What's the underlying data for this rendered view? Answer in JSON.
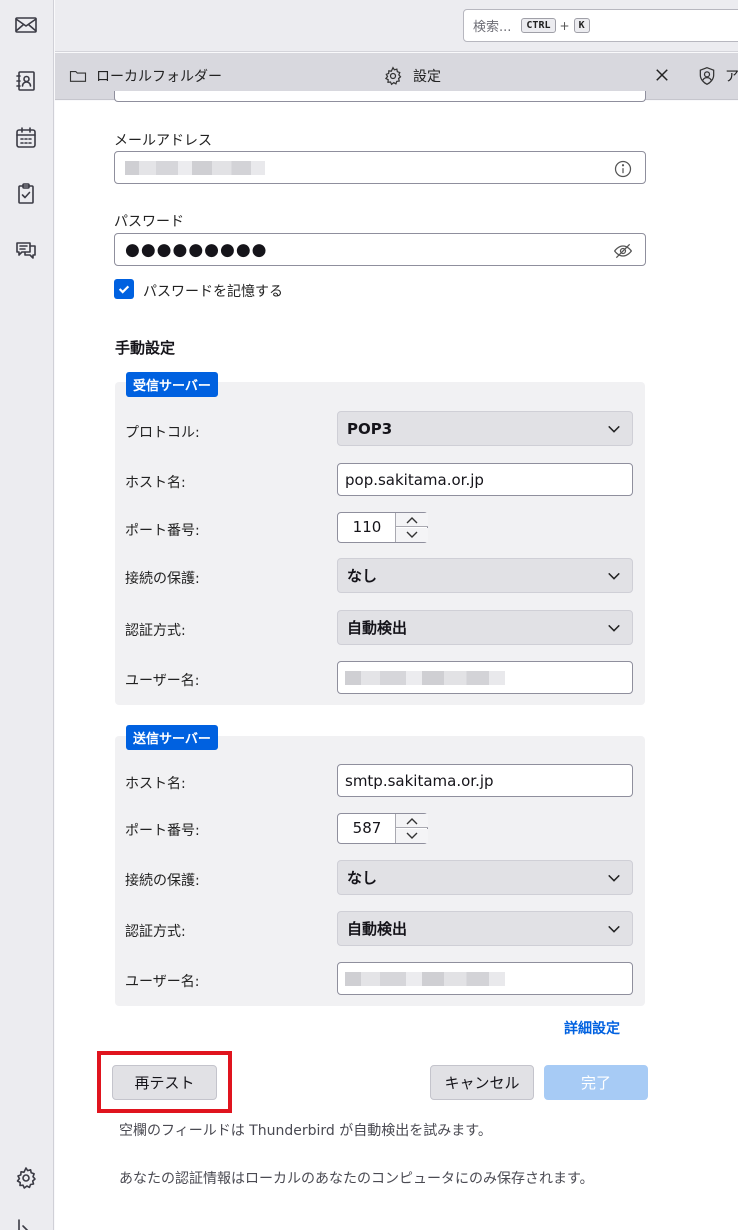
{
  "toolbar": {
    "search_placeholder": "検索...",
    "shortcut_key1": "CTRL",
    "shortcut_plus": "+",
    "shortcut_key2": "K"
  },
  "tabs": {
    "folder_tab": "ローカルフォルダー",
    "settings_tab": "設定",
    "account_tab": "ア"
  },
  "account": {
    "email_label": "メールアドレス",
    "email_value": "",
    "password_label": "パスワード",
    "password_value": "●●●●●●●●●",
    "remember_label": "パスワードを記憶する",
    "remember_checked": true
  },
  "manual": {
    "title": "手動設定",
    "incoming": {
      "badge": "受信サーバー",
      "protocol_label": "プロトコル:",
      "protocol_value": "POP3",
      "host_label": "ホスト名:",
      "host_value": "pop.sakitama.or.jp",
      "port_label": "ポート番号:",
      "port_value": "110",
      "security_label": "接続の保護:",
      "security_value": "なし",
      "auth_label": "認証方式:",
      "auth_value": "自動検出",
      "user_label": "ユーザー名:"
    },
    "outgoing": {
      "badge": "送信サーバー",
      "host_label": "ホスト名:",
      "host_value": "smtp.sakitama.or.jp",
      "port_label": "ポート番号:",
      "port_value": "587",
      "security_label": "接続の保護:",
      "security_value": "なし",
      "auth_label": "認証方式:",
      "auth_value": "自動検出",
      "user_label": "ユーザー名:"
    },
    "advanced_link": "詳細設定"
  },
  "actions": {
    "retest": "再テスト",
    "cancel": "キャンセル",
    "done": "完了"
  },
  "notes": {
    "note1": "空欄のフィールドは Thunderbird が自動検出を試みます。",
    "note2": "あなたの認証情報はローカルのあなたのコンピュータにのみ保存されます。"
  },
  "colors": {
    "accent": "#0061e0",
    "highlight": "#e0141e"
  }
}
